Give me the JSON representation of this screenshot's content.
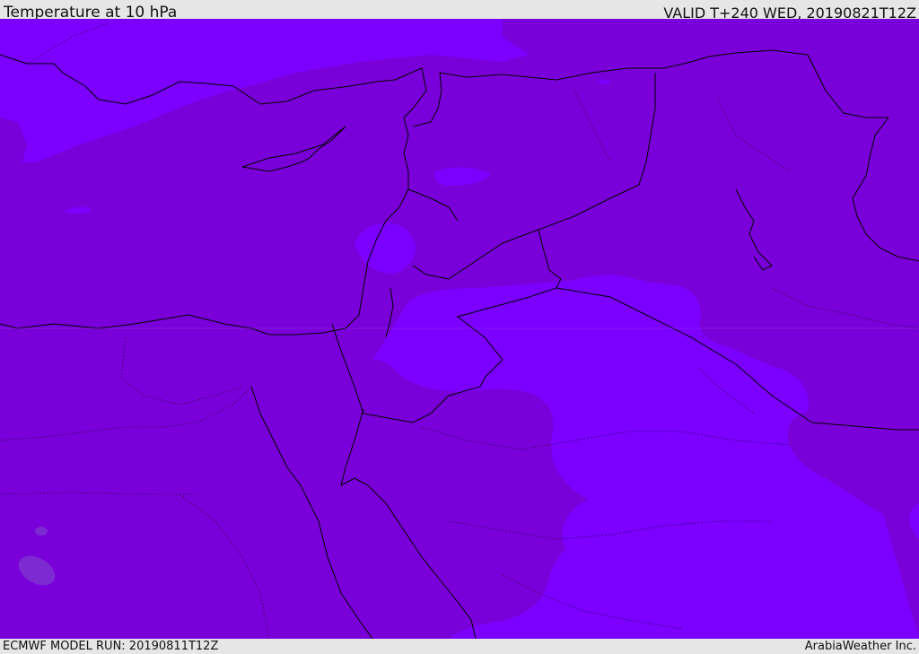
{
  "header": {
    "title": "Temperature at 10 hPa",
    "valid": "VALID T+240 WED, 20190821T12Z"
  },
  "footer": {
    "model_run": "ECMWF MODEL RUN: 20190811T12Z",
    "brand": "ArabiaWeather Inc."
  },
  "map": {
    "field": "temperature",
    "level": "10 hPa",
    "colors": {
      "dominant_fill": "#7a00d9",
      "lighter_fill": "#7b00ff",
      "faint_fill": "#7f3cd0",
      "coastline": "#000000"
    }
  }
}
